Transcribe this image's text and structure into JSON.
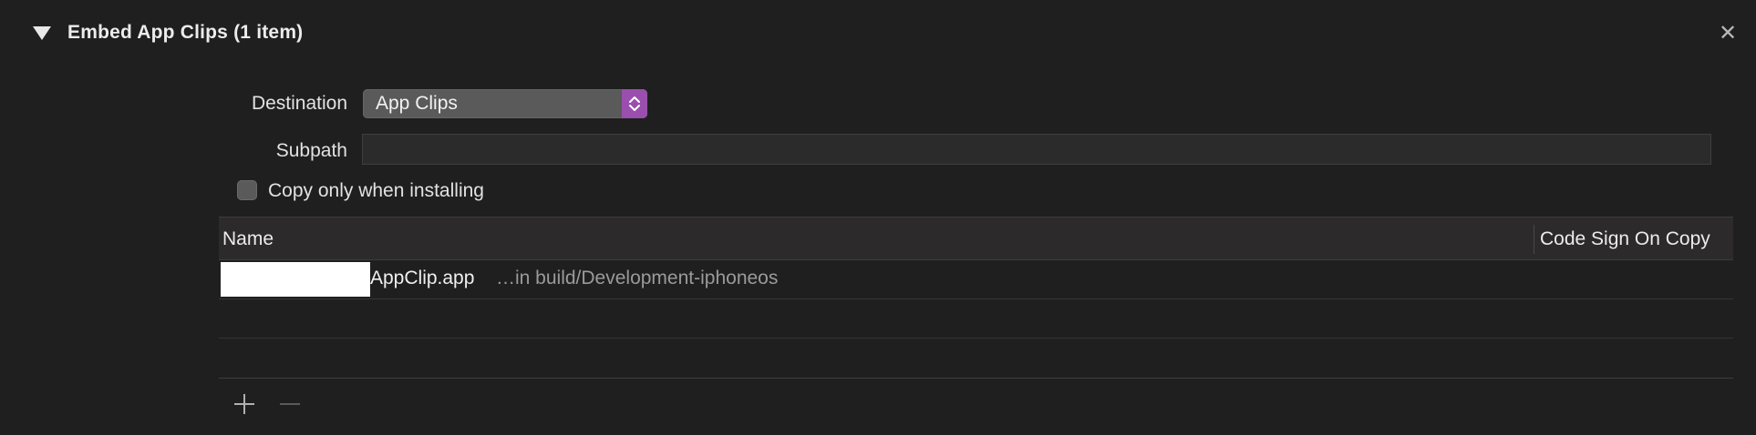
{
  "header": {
    "title": "Embed App Clips (1 item)",
    "close_glyph": "✕"
  },
  "form": {
    "destination_label": "Destination",
    "destination_value": "App Clips",
    "subpath_label": "Subpath",
    "subpath_value": "",
    "copy_only_label": "Copy only when installing",
    "copy_only_checked": false
  },
  "table": {
    "columns": [
      "Name",
      "Code Sign On Copy"
    ],
    "rows": [
      {
        "name": "AppClip.app",
        "location": "…in build/Development-iphoneos"
      }
    ]
  },
  "icons": {
    "disclosure": "disclosure-triangle-down-icon",
    "close": "close-icon",
    "stepper": "chevron-up-down-icon",
    "add": "plus-icon",
    "remove": "minus-icon"
  },
  "colors": {
    "background": "#1f1f1f",
    "popup_accent": "#9a4fae",
    "header_row": "#2c2a2a"
  }
}
